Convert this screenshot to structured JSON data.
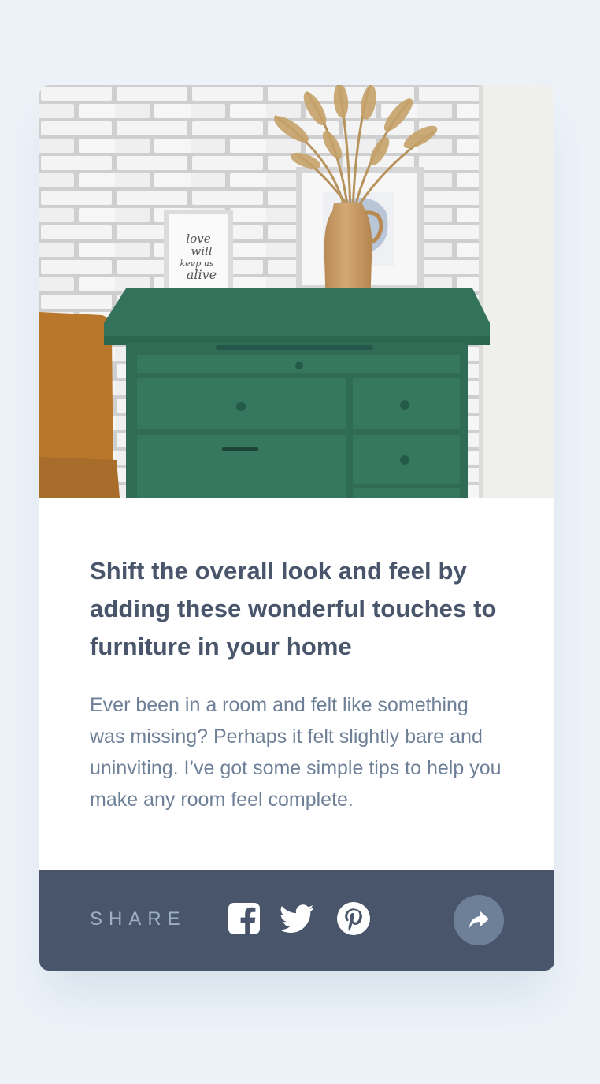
{
  "article": {
    "image_alt": "drawers",
    "title": "Shift the overall look and feel by adding these wonderful touches to furniture in your home",
    "excerpt": "Ever been in a room and felt like something was missing? Perhaps it felt slightly bare and uninviting. I’ve got some simple tips to help you make any room feel complete.",
    "frame_text": [
      "love",
      "will",
      "keep us",
      "alive"
    ]
  },
  "share": {
    "label": "SHARE",
    "icons": [
      "facebook-icon",
      "twitter-icon",
      "pinterest-icon",
      "share-arrow-icon"
    ]
  },
  "colors": {
    "background": "#ecf2f8",
    "heading": "#48556a",
    "body_text": "#6e8098",
    "footer": "#48556a",
    "share_label": "#9eafc2",
    "share_button": "#6e8098"
  }
}
